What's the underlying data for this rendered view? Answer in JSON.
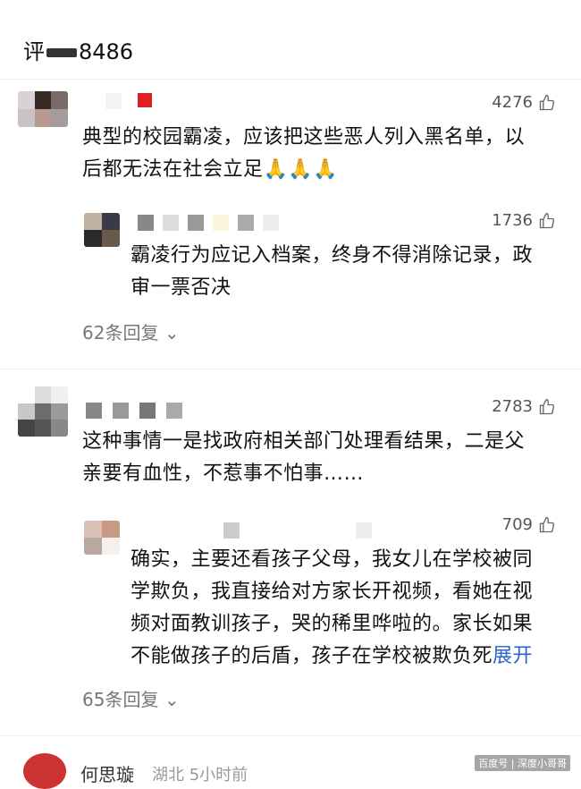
{
  "header": {
    "prefix": "评",
    "suffix": "8486"
  },
  "comments": [
    {
      "likes": "4276",
      "text_line1": "典型的校园霸凌，应该把这些恶人列入黑名单，以",
      "text_line2": "后都无法在社会立足🙏🙏🙏",
      "reply": {
        "likes": "1736",
        "text_line1": "霸凌行为应记入档案，终身不得消除记录，政",
        "text_line2": "审一票否决"
      },
      "replies_label": "62条回复"
    },
    {
      "likes": "2783",
      "text_line1": "这种事情一是找政府相关部门处理看结果，二是父",
      "text_line2": "亲要有血性，不惹事不怕事……",
      "reply": {
        "likes": "709",
        "text_line1": "确实，主要还看孩子父母，我女儿在学校被同",
        "text_line2": "学欺负，我直接给对方家长开视频，看她在视",
        "text_line3": "频对面教训孩子，哭的稀里哗啦的。家长如果",
        "text_line4": "不能做孩子的后盾，孩子在学校被欺负死",
        "expand_label": "展开"
      },
      "replies_label": "65条回复"
    }
  ],
  "next_comment": {
    "name": "何思璇",
    "meta": "湖北 5小时前"
  },
  "watermark": "百度号 | 深度小哥哥",
  "icons": {
    "like": "thumb-up-icon",
    "chevron": "chevron-down-icon"
  }
}
